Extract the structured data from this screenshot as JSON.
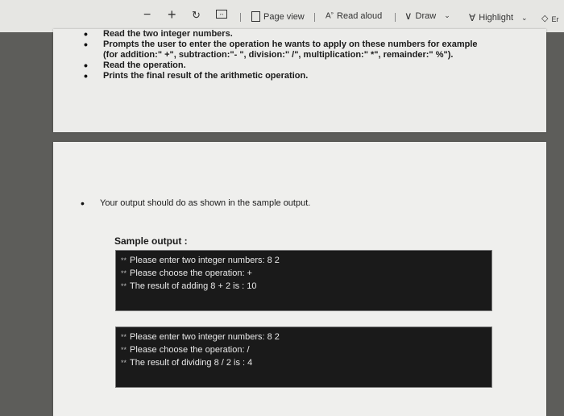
{
  "toolbar": {
    "minus_icon": "minus-icon",
    "plus_icon": "plus-icon",
    "page_view_label": "Page view",
    "read_aloud_label": "Read aloud",
    "draw_label": "Draw",
    "highlight_label": "Highlight",
    "erase_label": "Er"
  },
  "page1": {
    "items": [
      "Read the two integer numbers.",
      "Prompts the user to enter the operation he wants to apply on these numbers for example",
      "Read the operation.",
      "Prints the final result of the arithmetic operation."
    ],
    "item2_cont": "(for addition:\" +\", subtraction:\"- \", division:\" /\", multiplication:\" *\", remainder:\" %\")."
  },
  "page2": {
    "instruction": "Your output should do as shown in the sample output.",
    "sample_title": "Sample output :",
    "console1": [
      "Please enter two integer numbers: 8 2",
      "Please choose the operation: +",
      "The result of adding 8 + 2 is : 10"
    ],
    "console2": [
      "Please enter two integer numbers: 8 2",
      "Please choose the operation: /",
      "The result of dividing 8 / 2 is : 4"
    ]
  }
}
